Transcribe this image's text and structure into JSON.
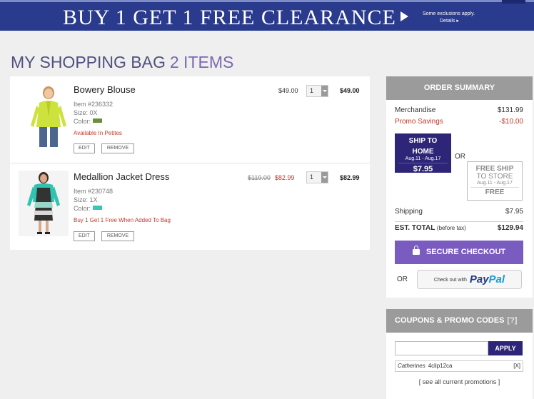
{
  "banner": {
    "headline": "BUY 1 GET 1 FREE CLEARANCE",
    "exclusions": "Some exclusions apply.",
    "details": "Details ▸"
  },
  "page": {
    "title": "MY SHOPPING BAG",
    "count": "2 ITEMS"
  },
  "cart": {
    "items": [
      {
        "name": "Bowery Blouse",
        "item_no": "Item #236332",
        "size": "Size: 0X",
        "color_label": "Color:",
        "swatch_color": "#6b8f3a",
        "note": "Available In Petites",
        "price": "$49.00",
        "qty": "1",
        "total": "$49.00",
        "edit_label": "EDIT",
        "remove_label": "REMOVE"
      },
      {
        "name": "Medallion Jacket Dress",
        "item_no": "Item #230748",
        "size": "Size: 1X",
        "color_label": "Color:",
        "swatch_color": "#3cc4b4",
        "note": "Buy 1 Get 1 Free When Added To Bag",
        "price_original": "$119.00",
        "price_sale": "$82.99",
        "qty": "1",
        "total": "$82.99",
        "edit_label": "EDIT",
        "remove_label": "REMOVE"
      }
    ]
  },
  "summary": {
    "heading": "ORDER SUMMARY",
    "merchandise_label": "Merchandise",
    "merchandise_value": "$131.99",
    "promo_label": "Promo Savings",
    "promo_value": "-$10.00",
    "ship_home": {
      "line1": "SHIP TO",
      "line2": "HOME",
      "dates": "Aug.11 - Aug.17",
      "price": "$7.95"
    },
    "or_label": "OR",
    "ship_store": {
      "line1": "FREE SHIP",
      "line2": "TO STORE",
      "dates": "Aug.11 - Aug.17",
      "price": "FREE"
    },
    "shipping_label": "Shipping",
    "shipping_value": "$7.95",
    "total_label": "EST. TOTAL",
    "total_note": "(before tax)",
    "total_value": "$129.94",
    "checkout_label": "SECURE CHECKOUT",
    "paypal_or": "OR",
    "paypal_prefix": "Check out with",
    "paypal_pay": "Pay",
    "paypal_pal": "Pal"
  },
  "coupons": {
    "heading": "COUPONS & PROMO CODES",
    "help": "[?]",
    "input_value": "",
    "apply_label": "APPLY",
    "applied_brand": "Catherines",
    "applied_code": "4clip12ca",
    "applied_remove": "[X]",
    "see_all": "[ see all current promotions ]"
  },
  "colors": {
    "banner": "#2a3a8c",
    "accent_purple": "#7a5bc0",
    "dark_purple": "#2d2577",
    "sale_red": "#c0392b"
  }
}
